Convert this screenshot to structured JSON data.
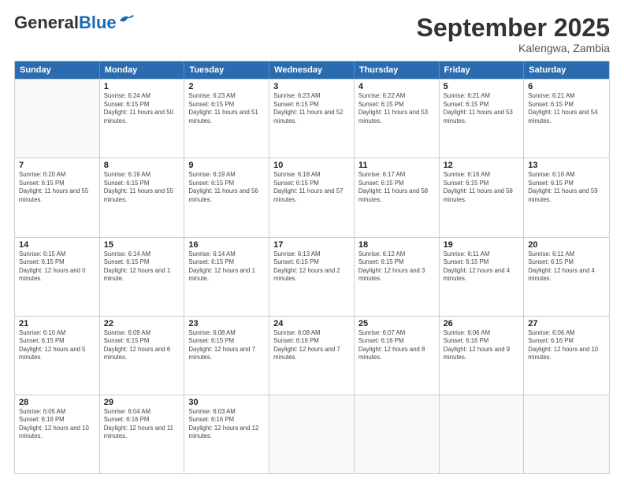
{
  "header": {
    "logo_general": "General",
    "logo_blue": "Blue",
    "month_title": "September 2025",
    "subtitle": "Kalengwa, Zambia"
  },
  "weekdays": [
    "Sunday",
    "Monday",
    "Tuesday",
    "Wednesday",
    "Thursday",
    "Friday",
    "Saturday"
  ],
  "weeks": [
    [
      {
        "day": "",
        "empty": true
      },
      {
        "day": "1",
        "sunrise": "6:24 AM",
        "sunset": "6:15 PM",
        "daylight": "11 hours and 50 minutes."
      },
      {
        "day": "2",
        "sunrise": "6:23 AM",
        "sunset": "6:15 PM",
        "daylight": "11 hours and 51 minutes."
      },
      {
        "day": "3",
        "sunrise": "6:23 AM",
        "sunset": "6:15 PM",
        "daylight": "11 hours and 52 minutes."
      },
      {
        "day": "4",
        "sunrise": "6:22 AM",
        "sunset": "6:15 PM",
        "daylight": "11 hours and 53 minutes."
      },
      {
        "day": "5",
        "sunrise": "6:21 AM",
        "sunset": "6:15 PM",
        "daylight": "11 hours and 53 minutes."
      },
      {
        "day": "6",
        "sunrise": "6:21 AM",
        "sunset": "6:15 PM",
        "daylight": "11 hours and 54 minutes."
      }
    ],
    [
      {
        "day": "7",
        "sunrise": "6:20 AM",
        "sunset": "6:15 PM",
        "daylight": "11 hours and 55 minutes."
      },
      {
        "day": "8",
        "sunrise": "6:19 AM",
        "sunset": "6:15 PM",
        "daylight": "11 hours and 55 minutes."
      },
      {
        "day": "9",
        "sunrise": "6:19 AM",
        "sunset": "6:15 PM",
        "daylight": "11 hours and 56 minutes."
      },
      {
        "day": "10",
        "sunrise": "6:18 AM",
        "sunset": "6:15 PM",
        "daylight": "11 hours and 57 minutes."
      },
      {
        "day": "11",
        "sunrise": "6:17 AM",
        "sunset": "6:15 PM",
        "daylight": "11 hours and 58 minutes."
      },
      {
        "day": "12",
        "sunrise": "6:16 AM",
        "sunset": "6:15 PM",
        "daylight": "11 hours and 58 minutes."
      },
      {
        "day": "13",
        "sunrise": "6:16 AM",
        "sunset": "6:15 PM",
        "daylight": "11 hours and 59 minutes."
      }
    ],
    [
      {
        "day": "14",
        "sunrise": "6:15 AM",
        "sunset": "6:15 PM",
        "daylight": "12 hours and 0 minutes."
      },
      {
        "day": "15",
        "sunrise": "6:14 AM",
        "sunset": "6:15 PM",
        "daylight": "12 hours and 1 minute."
      },
      {
        "day": "16",
        "sunrise": "6:14 AM",
        "sunset": "6:15 PM",
        "daylight": "12 hours and 1 minute."
      },
      {
        "day": "17",
        "sunrise": "6:13 AM",
        "sunset": "6:15 PM",
        "daylight": "12 hours and 2 minutes."
      },
      {
        "day": "18",
        "sunrise": "6:12 AM",
        "sunset": "6:15 PM",
        "daylight": "12 hours and 3 minutes."
      },
      {
        "day": "19",
        "sunrise": "6:11 AM",
        "sunset": "6:15 PM",
        "daylight": "12 hours and 4 minutes."
      },
      {
        "day": "20",
        "sunrise": "6:11 AM",
        "sunset": "6:15 PM",
        "daylight": "12 hours and 4 minutes."
      }
    ],
    [
      {
        "day": "21",
        "sunrise": "6:10 AM",
        "sunset": "6:15 PM",
        "daylight": "12 hours and 5 minutes."
      },
      {
        "day": "22",
        "sunrise": "6:09 AM",
        "sunset": "6:15 PM",
        "daylight": "12 hours and 6 minutes."
      },
      {
        "day": "23",
        "sunrise": "6:08 AM",
        "sunset": "6:15 PM",
        "daylight": "12 hours and 7 minutes."
      },
      {
        "day": "24",
        "sunrise": "6:08 AM",
        "sunset": "6:16 PM",
        "daylight": "12 hours and 7 minutes."
      },
      {
        "day": "25",
        "sunrise": "6:07 AM",
        "sunset": "6:16 PM",
        "daylight": "12 hours and 8 minutes."
      },
      {
        "day": "26",
        "sunrise": "6:06 AM",
        "sunset": "6:16 PM",
        "daylight": "12 hours and 9 minutes."
      },
      {
        "day": "27",
        "sunrise": "6:06 AM",
        "sunset": "6:16 PM",
        "daylight": "12 hours and 10 minutes."
      }
    ],
    [
      {
        "day": "28",
        "sunrise": "6:05 AM",
        "sunset": "6:16 PM",
        "daylight": "12 hours and 10 minutes."
      },
      {
        "day": "29",
        "sunrise": "6:04 AM",
        "sunset": "6:16 PM",
        "daylight": "12 hours and 11 minutes."
      },
      {
        "day": "30",
        "sunrise": "6:03 AM",
        "sunset": "6:16 PM",
        "daylight": "12 hours and 12 minutes."
      },
      {
        "day": "",
        "empty": true
      },
      {
        "day": "",
        "empty": true
      },
      {
        "day": "",
        "empty": true
      },
      {
        "day": "",
        "empty": true
      }
    ]
  ]
}
